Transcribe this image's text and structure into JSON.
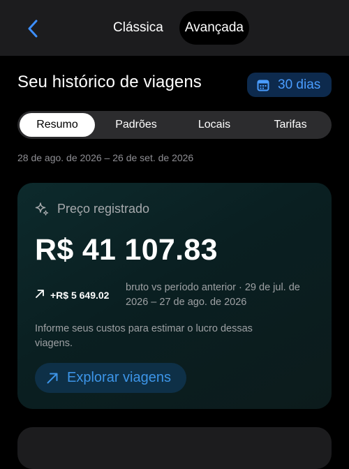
{
  "nav": {
    "back_icon": "chevron-left-icon",
    "modes": [
      {
        "label": "Clássica",
        "active": false
      },
      {
        "label": "Avançada",
        "active": true
      }
    ]
  },
  "header": {
    "title": "Seu histórico de viagens",
    "range_icon": "calendar-icon",
    "range_label": "30 dias"
  },
  "tabs": [
    {
      "label": "Resumo",
      "active": true
    },
    {
      "label": "Padrões",
      "active": false
    },
    {
      "label": "Locais",
      "active": false
    },
    {
      "label": "Tarifas",
      "active": false
    }
  ],
  "date_range": "28 de ago. de 2026 – 26 de set. de 2026",
  "summary": {
    "icon": "sparkle-icon",
    "label": "Preço registrado",
    "amount": "R$ 41 107.83",
    "delta_icon": "arrow-up-right-icon",
    "delta_value": "+R$ 5 649.02",
    "delta_note": "bruto vs período anterior · 29 de jul. de 2026 – 27 de ago. de 2026",
    "info": "Informe seus custos para estimar o lucro dessas viagens.",
    "explore_icon": "arrow-up-right-icon",
    "explore_label": "Explorar viagens"
  },
  "colors": {
    "accent": "#4a9dff",
    "background": "#000000",
    "surface": "#1c1c1e",
    "card": "#0d2a2c"
  }
}
